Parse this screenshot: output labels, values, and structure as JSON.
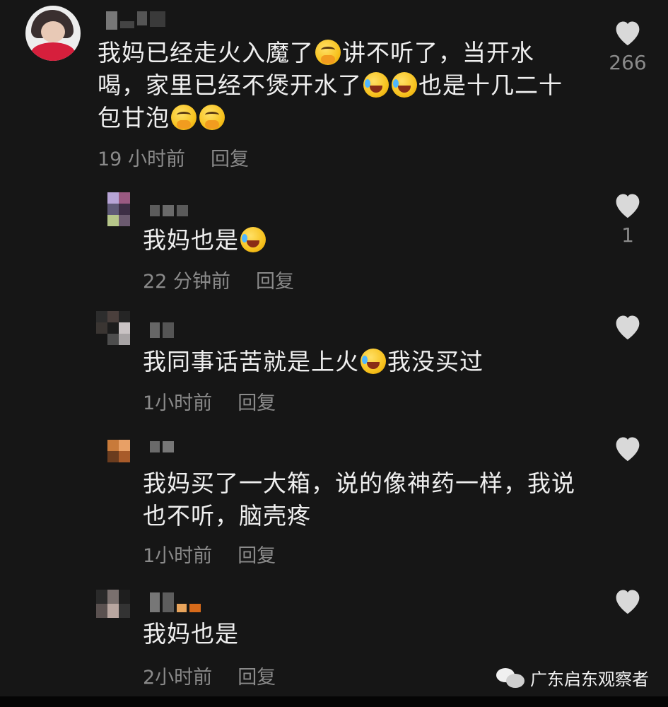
{
  "comments": [
    {
      "id": "c1",
      "text_parts": [
        "我妈已经走火入魔了",
        "讲不听了，当开水\n喝，家里已经不煲开水了",
        "也是十几二十\n包甘泡"
      ],
      "time": "19 小时前",
      "reply": "回复",
      "likes": "266"
    },
    {
      "id": "c2",
      "text_parts": [
        "我妈也是"
      ],
      "time": "22 分钟前",
      "reply": "回复",
      "likes": "1"
    },
    {
      "id": "c3",
      "text_parts": [
        "我同事话苦就是上火",
        "我没买过"
      ],
      "time": "1小时前",
      "reply": "回复",
      "likes": ""
    },
    {
      "id": "c4",
      "text_parts": [
        "我妈买了一大箱，说的像神药一样，我说\n也不听，脑壳疼"
      ],
      "time": "1小时前",
      "reply": "回复",
      "likes": ""
    },
    {
      "id": "c5",
      "text_parts": [
        "我妈也是"
      ],
      "time": "2小时前",
      "reply": "回复",
      "likes": ""
    }
  ],
  "watermark": {
    "text": "广东启东观察者",
    "icon": "wechat-icon"
  },
  "colors": {
    "background": "#161616",
    "text": "#efefef",
    "muted": "#8a8a8a",
    "heart": "#d9d9d9"
  }
}
